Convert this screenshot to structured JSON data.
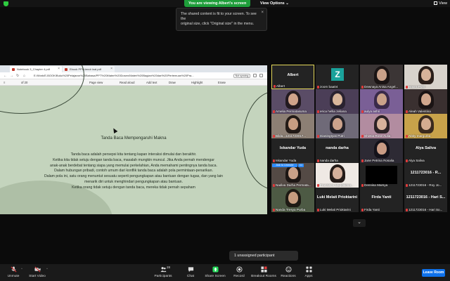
{
  "topbar": {
    "viewing_text": "You are viewing Albert's screen",
    "view_options": "View Options ⌄",
    "view_label": "View"
  },
  "tooltip": {
    "line1": "The shared content is fit to your screen. To see the",
    "line2": "original size, click \"Original size\" in the menu.",
    "close": "×"
  },
  "browser": {
    "tab1": "Notebook 3_Chapter 4.pdf",
    "tab2": "Ebook PPi Liendr inal.pdf",
    "url": "E:/Work/E-BOOK/Buku%20Pelajaran%20Bahasa/PPT%20Materi%20Dosen/Materi%20Bagian%20dari%20Pertemuan%20Pra...",
    "sync_label": "Not syncing",
    "page_field": "of 20",
    "pdf_tools": [
      "Page view",
      "Read aloud",
      "Add text",
      "Draw",
      "Highlight",
      "Erase"
    ]
  },
  "slide": {
    "title": "Tanda Baca Mempengaruhi Makna",
    "paragraphs": [
      "Tanda baca adalah persepsi kita tentang kapan interaksi dimulai dan berakhir.",
      "Ketika kita tidak setuju dengan tanda baca, masalah mungkin muncul. Jika Anda pernah mendengar",
      "anak-anak berdebat tentang siapa yang memulai perkelahian, Anda memahami pentingnya tanda baca.",
      "Dalam hubungan pribadi, contoh umum dari konflik tanda baca adalah pola permintaan-penarikan.",
      "Dalam pola ini, satu orang menuntut sesuatu seperti pengungkapan atau bantuan dengan tugas, dan yang lain",
      "menarik diri untuk menghindari pengungkapan atau bantuan.",
      "Ketika orang tidak setuju dengan tanda baca, mereka tidak pernah sepaham"
    ]
  },
  "gallery": [
    {
      "label": "Albert",
      "center": "Albert",
      "type": "name",
      "active": true
    },
    {
      "label": "zoom baa04",
      "type": "z",
      "avatar": "Z"
    },
    {
      "label": "Dewnaya Anisa Angel...",
      "type": "video",
      "bg": "#3b3535",
      "skin": "#c9a189",
      "hair": "#1a1414"
    },
    {
      "label": "Haura Putri",
      "type": "video",
      "bg": "#d8d3cc",
      "skin": "#d7b39a",
      "hair": "#2a1f1a"
    },
    {
      "label": "Amelia Permatasuma",
      "type": "video",
      "bg": "#5a4c66",
      "skin": "#cfa38a",
      "hair": "#231a20"
    },
    {
      "label": "erica hellia zeliana",
      "type": "video",
      "bg": "#4b3e57",
      "skin": "#d9b69b",
      "hair": "#2a2230"
    },
    {
      "label": "aulya ashri",
      "type": "video",
      "bg": "#7a5f96",
      "skin": "#caa28a",
      "hair": "#3a2a4a"
    },
    {
      "label": "Aleah Valentina",
      "type": "video",
      "bg": "#3a3030",
      "skin": "#d1a78d",
      "hair": "#1b1414"
    },
    {
      "label": "Bilda...1211723017...",
      "type": "video",
      "bg": "#8c7f74",
      "skin": "#c79d82",
      "hair": "#221a16"
    },
    {
      "label": "Dianingtyas Putri",
      "type": "video",
      "bg": "#6f6a78",
      "skin": "#cca38c",
      "hair": "#232027"
    },
    {
      "label": "Shintia Rose Aulia",
      "type": "video",
      "bg": "#b28ca0",
      "skin": "#d8b29c",
      "hair": "#2c2226"
    },
    {
      "label": "Abby margurita",
      "type": "video",
      "bg": "#c8a24a",
      "skin": "#d4ac90",
      "hair": "#3a2a1e"
    },
    {
      "label": "Iskandar Yuda",
      "center": "Iskandar Yuda",
      "type": "name"
    },
    {
      "label": "nanda darha",
      "center": "nanda darha",
      "type": "name"
    },
    {
      "label": "Jane Petrina Rosalia",
      "type": "video",
      "bg": "#2d2a34",
      "skin": "#c99b84",
      "hair": "#14121a"
    },
    {
      "label": "Alya Saliva",
      "center": "Alya Saliva",
      "type": "name"
    },
    {
      "label": "Nadiva Darha Permata...",
      "type": "unmute",
      "bg": "#544a45",
      "skin": "#c8a088",
      "hair": "#1c1614",
      "unmute_text": "Ask to Unmute",
      "dots": "•••"
    },
    {
      "label": "Fransisca Magdalena...",
      "type": "video",
      "bg": "#efe9e4",
      "skin": "#d5b09b",
      "hair": "#241b18"
    },
    {
      "label": "Dennisa Marsya",
      "type": "black"
    },
    {
      "label": "1211723016 - Roy Jo...",
      "center": "1211723016 - R...",
      "type": "name"
    },
    {
      "label": "Nanda Tresya Purba",
      "type": "video",
      "bg": "#4d5a44",
      "skin": "#c69c7f",
      "hair": "#1e1a14"
    },
    {
      "label": "Luki Melati Prioktarini",
      "center": "Luki Melati Prioktarini",
      "type": "name"
    },
    {
      "label": "Firda Yanti",
      "center": "Firda Yanti",
      "type": "name"
    },
    {
      "label": "1211723016 - Hari So...",
      "center": "1211723016 - Hari S...",
      "type": "name"
    }
  ],
  "unassigned": "1 unassigned participant",
  "toolbar": {
    "unmute": "Unmute",
    "start_video": "Start Video",
    "participants": "Participants",
    "participants_count": "28",
    "chat": "Chat",
    "share_screen": "Share Screen",
    "record": "Record",
    "breakout_rooms": "Breakout Rooms",
    "reactions": "Reactions",
    "apps": "Apps",
    "leave": "Leave Room"
  }
}
